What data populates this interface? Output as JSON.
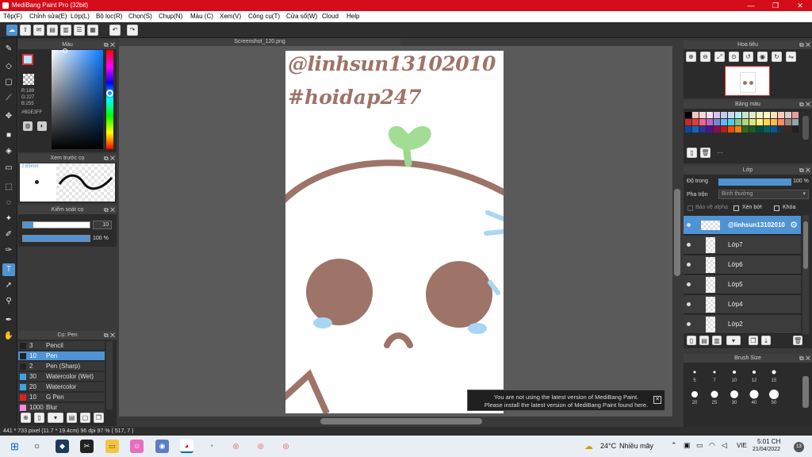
{
  "window": {
    "title": "MediBang Paint Pro (32bit)",
    "minimize": "—",
    "restore": "❐",
    "close": "✕"
  },
  "menu": [
    "Tệp(F)",
    "Chỉnh sửa(E)",
    "Lớp(L)",
    "Bộ lọc(R)",
    "Chọn(S)",
    "Chụp(N)",
    "Màu (C)",
    "Xem(V)",
    "Công cụ(T)",
    "Cửa sổ(W)",
    "Cloud",
    "Help"
  ],
  "color_panel": {
    "title": "Màu",
    "r": "R:189",
    "g": "G:227",
    "b": "B:255",
    "hex": "#BDE3FF",
    "foreground": "#BDE3FF",
    "background": "#ffffff"
  },
  "brush_preview": {
    "title": "Xem trước cọ",
    "size": "2.65mm"
  },
  "brush_control": {
    "title": "Kiểm soát cọ",
    "size_value": "10",
    "opacity_value": "100 %",
    "opacity": 1.0,
    "size_fraction": 0.15
  },
  "brush_panel": {
    "title": "Cọ: Pen",
    "items": [
      {
        "size": "3",
        "name": "Pencil",
        "color": "#222222"
      },
      {
        "size": "10",
        "name": "Pen",
        "color": "#222222"
      },
      {
        "size": "2",
        "name": "Pen (Sharp)",
        "color": "#222222"
      },
      {
        "size": "30",
        "name": "Watercolor (Wet)",
        "color": "#3aa6e0"
      },
      {
        "size": "20",
        "name": "Watercolor",
        "color": "#3aa6e0"
      },
      {
        "size": "10",
        "name": "G Pen",
        "color": "#e02020"
      },
      {
        "size": "1000",
        "name": "Blur",
        "color": "#ff88dd"
      }
    ]
  },
  "document": {
    "tab": "Screenshot_120.png",
    "text_line1": "@linhsun13102010",
    "text_line2": "#hoidap247"
  },
  "navigator": {
    "title": "Hoa tiêu"
  },
  "palette": {
    "title": "Bảng màu",
    "more": "···"
  },
  "layer_panel": {
    "title": "Lớp",
    "opacity_label": "Độ trong",
    "opacity_value": "100 %",
    "blend_label": "Pha trộn",
    "blend_value": "Bình thường",
    "protect_alpha": "Bảo vệ alpha",
    "clipping": "Xén bớt",
    "lock": "Khóa",
    "layers": [
      "@linhsun13102010",
      "Lớp7",
      "Lớp6",
      "Lớp5",
      "Lớp4",
      "Lớp2"
    ]
  },
  "brush_size": {
    "title": "Brush Size",
    "values": [
      "5",
      "7",
      "10",
      "12",
      "15",
      "20",
      "25",
      "30",
      "40",
      "50"
    ]
  },
  "status": {
    "text": "441 * 733 pixel   (11.7 * 19.4cm)   96 dpi   97 %   ( 517, 7 )"
  },
  "notification": {
    "line1": "You are not using the latest version of MediBang Paint.",
    "line2": "Please install the latest version of MediBang Paint found here."
  },
  "taskbar": {
    "weather_temp": "24°C",
    "weather_desc": "Nhiều mây",
    "lang": "VIE",
    "time": "5:01 CH",
    "date": "21/04/2022",
    "notif_count": "13"
  }
}
